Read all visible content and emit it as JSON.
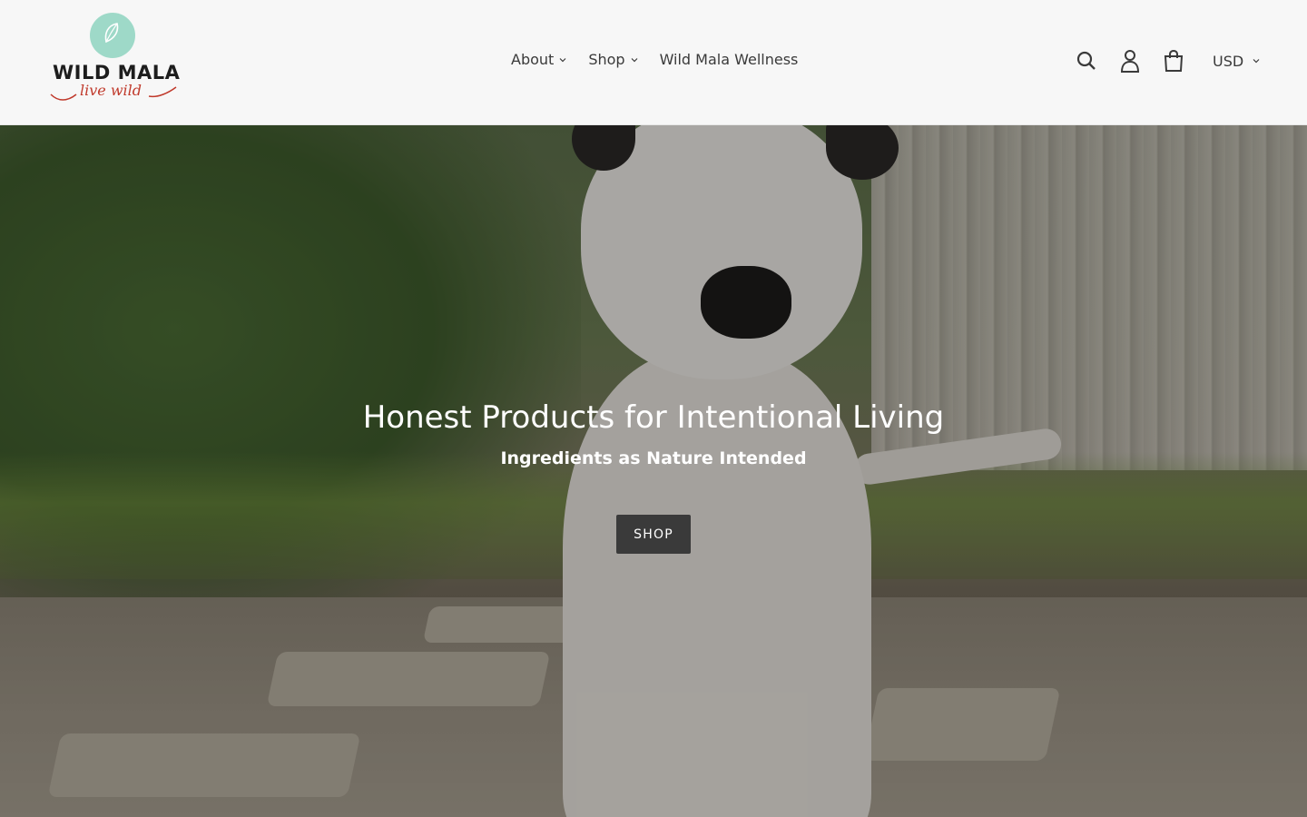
{
  "brand": {
    "name": "WILD MALA",
    "tagline": "live wild",
    "accent_color": "#9ed9c8",
    "tagline_color": "#c0392b"
  },
  "nav": {
    "items": [
      {
        "label": "About",
        "has_dropdown": true
      },
      {
        "label": "Shop",
        "has_dropdown": true
      },
      {
        "label": "Wild Mala Wellness",
        "has_dropdown": false
      }
    ]
  },
  "header_icons": {
    "search": "search-icon",
    "account": "user-icon",
    "cart": "cart-icon"
  },
  "currency": {
    "selected": "USD"
  },
  "hero": {
    "title": "Honest Products for Intentional Living",
    "subtitle": "Ingredients as Nature Intended",
    "button_label": "SHOP",
    "button_color": "#3a3a3a"
  }
}
